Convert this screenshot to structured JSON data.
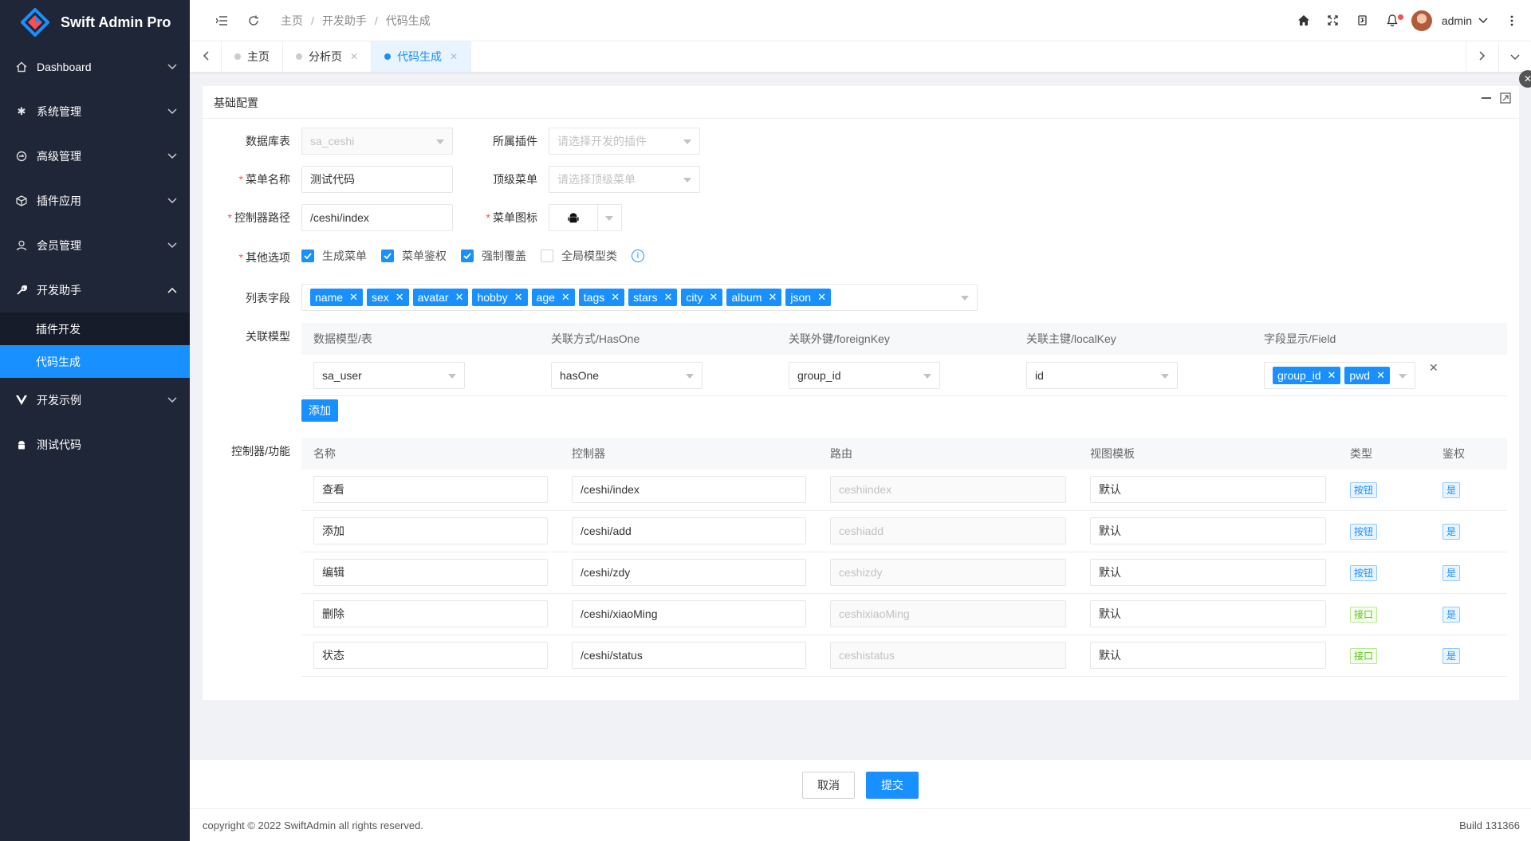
{
  "app": {
    "title": "Swift Admin Pro"
  },
  "sidebar": {
    "items": [
      {
        "label": "Dashboard",
        "icon": "home-outline-icon"
      },
      {
        "label": "系统管理",
        "icon": "gear-icon"
      },
      {
        "label": "高级管理",
        "icon": "sign-icon"
      },
      {
        "label": "插件应用",
        "icon": "cube-icon"
      },
      {
        "label": "会员管理",
        "icon": "user-icon"
      },
      {
        "label": "开发助手",
        "icon": "wrench-icon",
        "expanded": true,
        "children": [
          {
            "label": "插件开发"
          },
          {
            "label": "代码生成",
            "active": true
          }
        ]
      },
      {
        "label": "开发示例",
        "icon": "vue-icon"
      },
      {
        "label": "测试代码",
        "icon": "android-icon"
      }
    ]
  },
  "header": {
    "breadcrumb": [
      "主页",
      "开发助手",
      "代码生成"
    ],
    "username": "admin"
  },
  "tabs": [
    {
      "label": "主页",
      "closable": false,
      "active": false
    },
    {
      "label": "分析页",
      "closable": true,
      "active": false
    },
    {
      "label": "代码生成",
      "closable": true,
      "active": true
    }
  ],
  "card": {
    "title": "基础配置"
  },
  "form": {
    "db_table": {
      "label": "数据库表",
      "value": "sa_ceshi"
    },
    "plugin": {
      "label": "所属插件",
      "placeholder": "请选择开发的插件"
    },
    "menu_name": {
      "label": "菜单名称",
      "value": "测试代码"
    },
    "top_menu": {
      "label": "顶级菜单",
      "placeholder": "请选择顶级菜单"
    },
    "controller_path": {
      "label": "控制器路径",
      "value": "/ceshi/index"
    },
    "menu_icon": {
      "label": "菜单图标",
      "icon": "android-icon"
    },
    "options": {
      "label": "其他选项",
      "items": [
        {
          "label": "生成菜单",
          "checked": true
        },
        {
          "label": "菜单鉴权",
          "checked": true
        },
        {
          "label": "强制覆盖",
          "checked": true
        },
        {
          "label": "全局模型类",
          "checked": false
        }
      ],
      "info": "i"
    },
    "list_fields": {
      "label": "列表字段",
      "tags": [
        "name",
        "sex",
        "avatar",
        "hobby",
        "age",
        "tags",
        "stars",
        "city",
        "album",
        "json"
      ]
    },
    "relation": {
      "label": "关联模型",
      "headers": [
        "数据模型/表",
        "关联方式/HasOne",
        "关联外键/foreignKey",
        "关联主键/localKey",
        "字段显示/Field"
      ],
      "rows": [
        {
          "model": "sa_user",
          "type": "hasOne",
          "foreign_key": "group_id",
          "local_key": "id",
          "fields": [
            "group_id",
            "pwd"
          ]
        }
      ],
      "add_label": "添加"
    },
    "controller": {
      "label": "控制器/功能",
      "headers": [
        "名称",
        "控制器",
        "路由",
        "视图模板",
        "类型",
        "鉴权"
      ],
      "rows": [
        {
          "name": "查看",
          "controller": "/ceshi/index",
          "route": "ceshiindex",
          "view": "默认",
          "type": "按钮",
          "type_color": "blue",
          "auth": "是"
        },
        {
          "name": "添加",
          "controller": "/ceshi/add",
          "route": "ceshiadd",
          "view": "默认",
          "type": "按钮",
          "type_color": "blue",
          "auth": "是"
        },
        {
          "name": "编辑",
          "controller": "/ceshi/zdy",
          "route": "ceshizdy",
          "view": "默认",
          "type": "按钮",
          "type_color": "blue",
          "auth": "是"
        },
        {
          "name": "删除",
          "controller": "/ceshi/xiaoMing",
          "route": "ceshixiaoMing",
          "view": "默认",
          "type": "接口",
          "type_color": "green",
          "auth": "是"
        },
        {
          "name": "状态",
          "controller": "/ceshi/status",
          "route": "ceshistatus",
          "view": "默认",
          "type": "接口",
          "type_color": "green",
          "auth": "是"
        }
      ]
    }
  },
  "actions": {
    "cancel": "取消",
    "submit": "提交"
  },
  "footer": {
    "copyright": "copyright © 2022 SwiftAdmin all rights reserved.",
    "build": "Build 131366"
  },
  "colors": {
    "primary": "#1890ff",
    "sidebar": "#1f2637",
    "danger": "#ff4d4f"
  }
}
